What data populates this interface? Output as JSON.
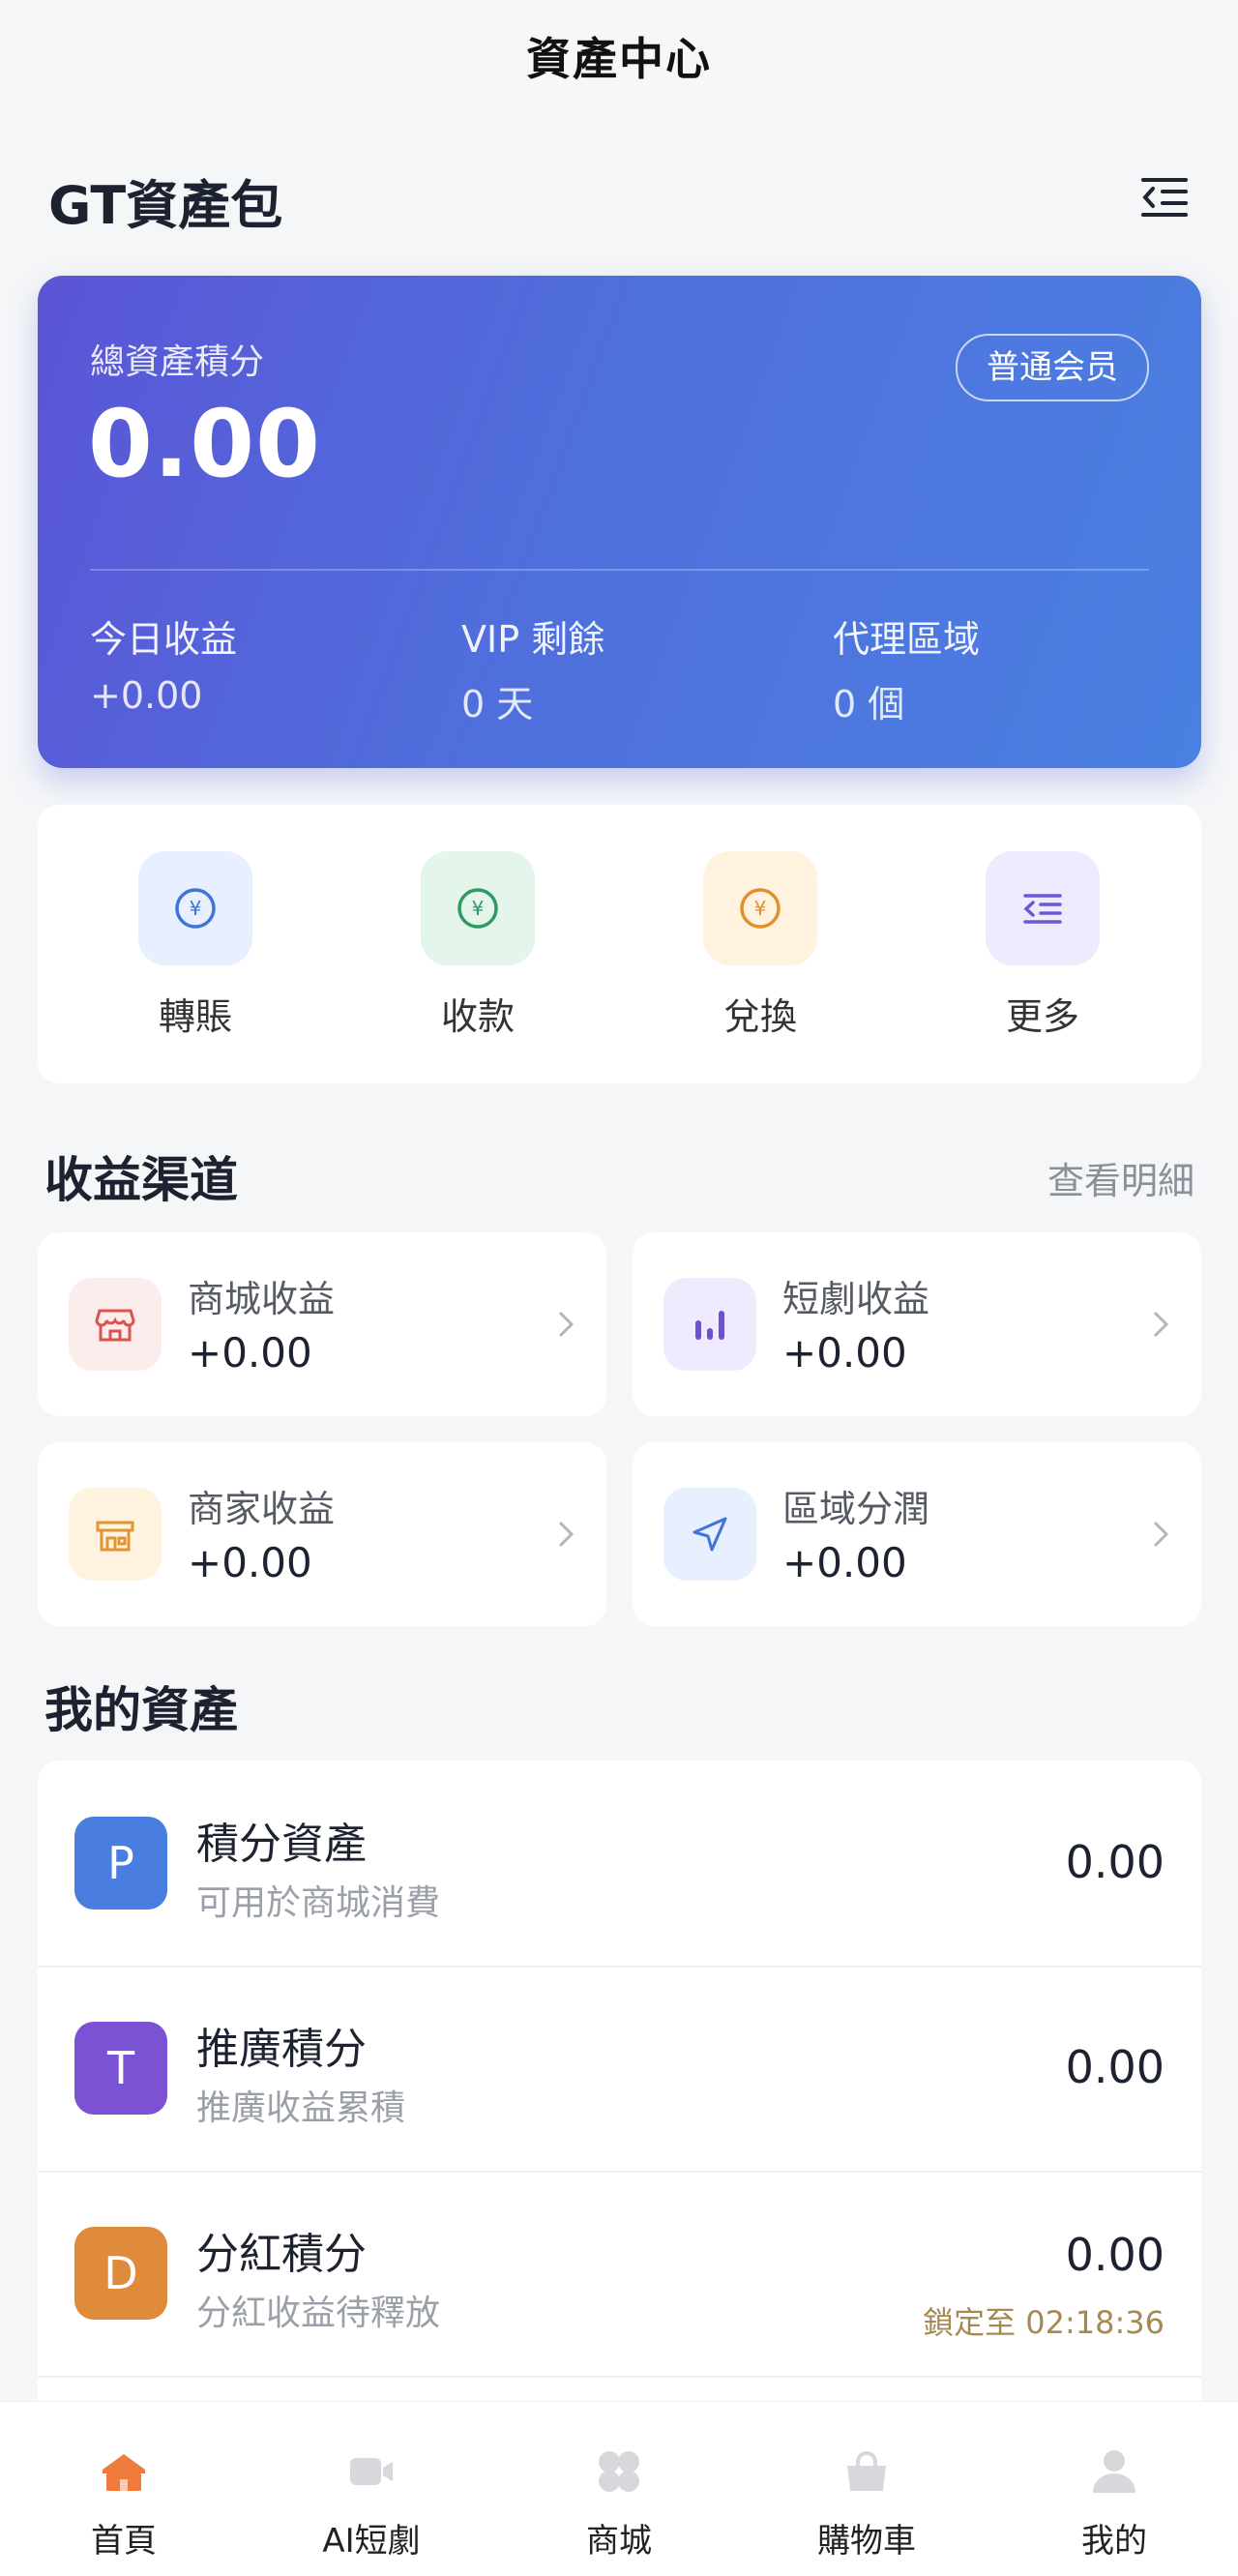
{
  "top_bar": {
    "title": "資產中心"
  },
  "header": {
    "title": "GT資產包",
    "menu_icon": "list-indent-icon"
  },
  "summary_card": {
    "label": "總資產積分",
    "value": "0.00",
    "badge": "普通会员",
    "stats": [
      {
        "label": "今日收益",
        "value": "+0.00"
      },
      {
        "label": "VIP 剩餘",
        "value": "0 天"
      },
      {
        "label": "代理區域",
        "value": "0 個"
      }
    ]
  },
  "quick_actions": [
    {
      "label": "轉賬",
      "icon": "yen-coin-icon",
      "color": "#3f74d8",
      "bg": "#e8efff"
    },
    {
      "label": "收款",
      "icon": "yen-coin-icon",
      "color": "#2f9a63",
      "bg": "#e4f5ec"
    },
    {
      "label": "兌換",
      "icon": "yen-coin-icon",
      "color": "#e0912d",
      "bg": "#fff2de"
    },
    {
      "label": "更多",
      "icon": "list-indent-icon",
      "color": "#6d58d3",
      "bg": "#efeafe"
    }
  ],
  "channels": {
    "title": "收益渠道",
    "link": "查看明細",
    "items": [
      {
        "label": "商城收益",
        "value": "+0.00",
        "icon": "store-icon",
        "color": "#d9534f",
        "bg": "#fdecec"
      },
      {
        "label": "短劇收益",
        "value": "+0.00",
        "icon": "bar-chart-icon",
        "color": "#6a52d0",
        "bg": "#efeafe"
      },
      {
        "label": "商家收益",
        "value": "+0.00",
        "icon": "shop-icon",
        "color": "#e09530",
        "bg": "#fff3df"
      },
      {
        "label": "區域分潤",
        "value": "+0.00",
        "icon": "navigation-icon",
        "color": "#3f74d8",
        "bg": "#e8efff"
      }
    ]
  },
  "assets": {
    "title": "我的資產",
    "items": [
      {
        "letter": "P",
        "name": "積分資產",
        "desc": "可用於商城消費",
        "value": "0.00",
        "lock": "",
        "color": "#4a7de0"
      },
      {
        "letter": "T",
        "name": "推廣積分",
        "desc": "推廣收益累積",
        "value": "0.00",
        "lock": "",
        "color": "#7b52d4"
      },
      {
        "letter": "D",
        "name": "分紅積分",
        "desc": "分紅收益待釋放",
        "value": "0.00",
        "lock": "鎖定至 02:18:36",
        "color": "#e08a3c"
      }
    ]
  },
  "tab_bar": [
    {
      "label": "首頁",
      "icon": "home-icon",
      "active": true,
      "color": "#ee7a3b"
    },
    {
      "label": "AI短劇",
      "icon": "video-icon",
      "active": false,
      "color": "#d6d8dc"
    },
    {
      "label": "商城",
      "icon": "grid-icon",
      "active": false,
      "color": "#d6d8dc"
    },
    {
      "label": "購物車",
      "icon": "bag-icon",
      "active": false,
      "color": "#d6d8dc"
    },
    {
      "label": "我的",
      "icon": "user-icon",
      "active": false,
      "color": "#d6d8dc"
    }
  ]
}
